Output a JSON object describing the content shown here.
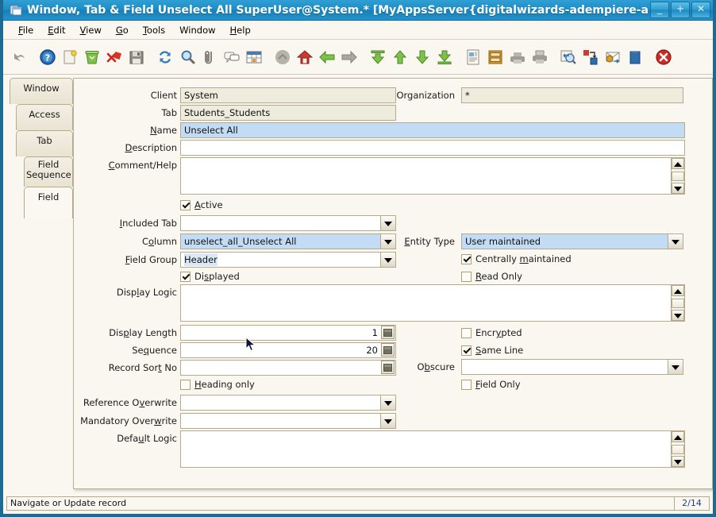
{
  "window": {
    "title": "Window, Tab & Field  Unselect All  SuperUser@System.* [MyAppsServer{digitalwizards-adempiere-adem",
    "icon": "window-app-icon",
    "buttons": {
      "minimize": "_",
      "maximize": "+",
      "close": "✕"
    }
  },
  "menubar": {
    "items": [
      {
        "name": "file",
        "pre": "",
        "key": "F",
        "post": "ile"
      },
      {
        "name": "edit",
        "pre": "",
        "key": "E",
        "post": "dit"
      },
      {
        "name": "view",
        "pre": "",
        "key": "V",
        "post": "iew"
      },
      {
        "name": "go",
        "pre": "",
        "key": "G",
        "post": "o"
      },
      {
        "name": "tools",
        "pre": "",
        "key": "T",
        "post": "ools"
      },
      {
        "name": "window",
        "pre": "Window",
        "key": "",
        "post": ""
      },
      {
        "name": "help",
        "pre": "",
        "key": "H",
        "post": "elp"
      }
    ]
  },
  "toolbar": {
    "items": [
      "undo-icon",
      "help-icon",
      "new-record-icon",
      "delete-record-icon",
      "delete-selection-icon",
      "save-icon",
      "refresh-icon",
      "find-icon",
      "attachment-icon",
      "chat-icon",
      "grid-toggle-icon",
      "parent-record-icon",
      "home-icon",
      "back-icon",
      "forward-icon",
      "first-record-icon",
      "previous-record-icon",
      "next-record-icon",
      "last-record-icon",
      "report-icon",
      "archive-icon",
      "print-preview-icon",
      "print-icon",
      "zoom-across-icon",
      "active-workflow-icon",
      "request-icon",
      "product-info-icon",
      "exit-icon"
    ]
  },
  "tabstack": {
    "items": [
      {
        "name": "tab-window",
        "label": "Window",
        "selected": false
      },
      {
        "name": "tab-access",
        "label": "Access",
        "selected": false
      },
      {
        "name": "tab-tab",
        "label": "Tab",
        "selected": false
      },
      {
        "name": "tab-field-sequence",
        "label": "Field\nSequence",
        "selected": false
      },
      {
        "name": "tab-field",
        "label": "Field",
        "selected": true
      }
    ]
  },
  "form": {
    "client": {
      "label": "Client",
      "value": "System",
      "mnemonic": ""
    },
    "organization": {
      "label": "Organization",
      "value": "*",
      "mnemonic": ""
    },
    "tab": {
      "label": "Tab",
      "value": "Students_Students",
      "mnemonic": ""
    },
    "name": {
      "label_pre": "",
      "label_key": "N",
      "label_post": "ame",
      "value": "Unselect All"
    },
    "description": {
      "label_pre": "",
      "label_key": "D",
      "label_post": "escription",
      "value": ""
    },
    "comment_help": {
      "label_pre": "",
      "label_key": "C",
      "label_post": "omment/Help",
      "value": ""
    },
    "active": {
      "label_pre": "",
      "label_key": "A",
      "label_post": "ctive",
      "checked": true
    },
    "included_tab": {
      "label_pre": "",
      "label_key": "I",
      "label_post": "ncluded Tab",
      "value": ""
    },
    "column": {
      "label_pre": "C",
      "label_key": "o",
      "label_post": "lumn",
      "value": "unselect_all_Unselect All"
    },
    "field_group": {
      "label_pre": "",
      "label_key": "F",
      "label_post": "ield Group",
      "value": "Header"
    },
    "displayed": {
      "label_pre": "Di",
      "label_key": "s",
      "label_post": "played",
      "checked": true
    },
    "entity_type": {
      "label_pre": "",
      "label_key": "E",
      "label_post": "ntity Type",
      "value": "User maintained"
    },
    "centrally_maintained": {
      "label_pre": "Centrally ",
      "label_key": "m",
      "label_post": "aintained",
      "checked": true
    },
    "read_only": {
      "label_pre": "",
      "label_key": "R",
      "label_post": "ead Only",
      "checked": false
    },
    "display_logic": {
      "label_pre": "Disp",
      "label_key": "l",
      "label_post": "ay Logic",
      "value": ""
    },
    "display_length": {
      "label_pre": "Dis",
      "label_key": "p",
      "label_post": "lay Length",
      "value": "1"
    },
    "sequence": {
      "label_pre": "Se",
      "label_key": "q",
      "label_post": "uence",
      "value": "20"
    },
    "record_sort_no": {
      "label_pre": "Record Sor",
      "label_key": "t",
      "label_post": " No",
      "value": ""
    },
    "encrypted": {
      "label_pre": "Encr",
      "label_key": "y",
      "label_post": "pted",
      "checked": false
    },
    "same_line": {
      "label_pre": "",
      "label_key": "S",
      "label_post": "ame Line",
      "checked": true
    },
    "obscure": {
      "label_pre": "O",
      "label_key": "b",
      "label_post": "scure",
      "value": ""
    },
    "field_only": {
      "label_pre": "",
      "label_key": "F",
      "label_post": "ield Only",
      "checked": false
    },
    "heading_only": {
      "label_pre": "",
      "label_key": "H",
      "label_post": "eading only",
      "checked": false
    },
    "reference_overwrite": {
      "label_pre": "Reference O",
      "label_key": "v",
      "label_post": "erwrite",
      "value": ""
    },
    "mandatory_overwrite": {
      "label_pre": "Mandatory Over",
      "label_key": "w",
      "label_post": "rite",
      "value": ""
    },
    "default_logic": {
      "label_pre": "Defa",
      "label_key": "u",
      "label_post": "lt Logic",
      "value": ""
    }
  },
  "statusbar": {
    "message": "Navigate or Update record",
    "count": "2/14"
  },
  "colors": {
    "titlebar": "#1e8ec6",
    "frame": "#1b6b93",
    "panel": "#faf7f0",
    "field_border": "#b5aa8e",
    "selected_field": "#c3dcf5",
    "readonly_field": "#eeecdc",
    "status_count": "#1b3f8f"
  }
}
